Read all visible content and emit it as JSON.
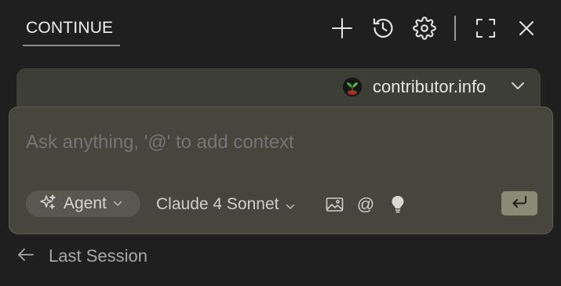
{
  "header": {
    "tab_title": "CONTINUE",
    "icons": [
      "plus-icon",
      "history-icon",
      "gear-icon",
      "fullscreen-icon",
      "close-icon"
    ]
  },
  "context": {
    "label": "contributor.info",
    "avatar_icon": "seedling-avatar-icon"
  },
  "input": {
    "placeholder": "Ask anything, '@' to add context",
    "mode_label": "Agent",
    "model_label": "Claude 4 Sonnet",
    "tools": [
      "image-icon",
      "at-mention-icon",
      "lightbulb-icon"
    ],
    "at_glyph": "@",
    "send_icon": "enter-icon"
  },
  "footer": {
    "last_session_label": "Last Session"
  },
  "colors": {
    "background": "#1f1f1f",
    "context_bar": "#3d3e36",
    "input_box": "#46463d",
    "send_button": "#8b8a76"
  }
}
